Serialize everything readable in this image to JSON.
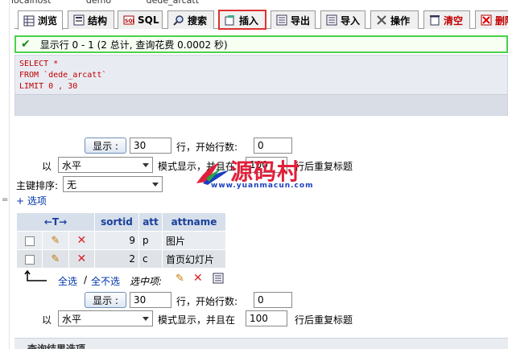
{
  "breadcrumbs": [
    "localhost",
    "demo",
    "dede_arcatt"
  ],
  "tabs": [
    {
      "label": "浏览",
      "icon": "browse-icon"
    },
    {
      "label": "结构",
      "icon": "structure-icon"
    },
    {
      "label": "SQL",
      "icon": "sql-icon"
    },
    {
      "label": "搜索",
      "icon": "search-icon"
    },
    {
      "label": "插入",
      "icon": "insert-icon"
    },
    {
      "label": "导出",
      "icon": "export-icon"
    },
    {
      "label": "导入",
      "icon": "import-icon"
    },
    {
      "label": "操作",
      "icon": "operations-icon"
    },
    {
      "label": "清空",
      "icon": "empty-icon"
    },
    {
      "label": "删除",
      "icon": "drop-icon"
    }
  ],
  "notice": {
    "text": "显示行  0 - 1 (2 总计, 查询花费  0.0002 秒)"
  },
  "sql": {
    "line1": "SELECT *",
    "line2": "FROM `dede_arcatt`",
    "line3": "LIMIT 0 , 30"
  },
  "nav_top": {
    "show_button": "显示 :",
    "rows_value": "30",
    "rows_label": "行，开始行数:",
    "start_value": "0",
    "mode_prefix": "以",
    "mode_value": "水平",
    "mode_label": "模式显示，并且在",
    "repeat_value": "100",
    "repeat_label": "行后重复标题",
    "sort_label": "主键排序:",
    "sort_value": "无",
    "options_link": "+ 选项"
  },
  "table": {
    "nav_arrows": "←T→",
    "headers": [
      "sortid",
      "att",
      "attname"
    ],
    "rows": [
      {
        "sortid": "9",
        "att": "p",
        "attname": "图片"
      },
      {
        "sortid": "2",
        "att": "c",
        "attname": "首页幻灯片"
      }
    ]
  },
  "bulk": {
    "check_all": "全选",
    "separator": "/",
    "uncheck_all": "全不选",
    "selected_label": "选中项:"
  },
  "nav_bottom": {
    "show_button": "显示 :",
    "rows_value": "30",
    "rows_label": "行，开始行数:",
    "start_value": "0",
    "mode_prefix": "以",
    "mode_value": "水平",
    "mode_label": "模式显示，并且在",
    "repeat_value": "100",
    "repeat_label": "行后重复标题"
  },
  "footer": {
    "title": "查询结果选项"
  },
  "watermark": {
    "main": "源码村",
    "sub": "www.yuanmacun.com"
  },
  "colors": {
    "accent": "#1a3f9a",
    "success_border": "#4ad24a",
    "highlight": "#e03030",
    "sql_text": "#c00000"
  }
}
